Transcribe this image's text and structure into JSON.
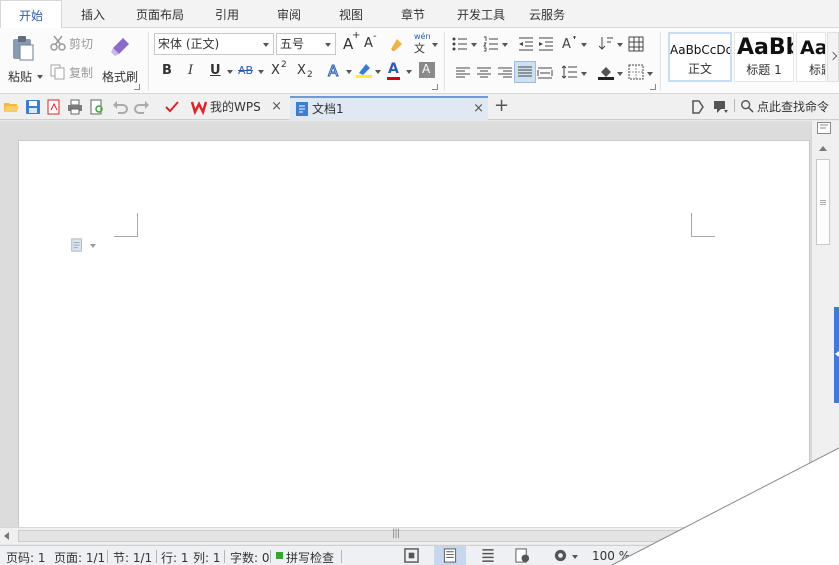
{
  "menu": {
    "tabs": [
      "开始",
      "插入",
      "页面布局",
      "引用",
      "审阅",
      "视图",
      "章节",
      "开发工具",
      "云服务"
    ],
    "active_index": 0
  },
  "clipboard": {
    "paste_label": "粘贴",
    "cut_label": "剪切",
    "copy_label": "复制",
    "format_painter_label": "格式刷"
  },
  "font": {
    "family_value": "宋体 (正文)",
    "size_value": "五号",
    "bold_glyph": "B",
    "italic_glyph": "I",
    "underline_glyph": "U",
    "strike_glyph": "AB",
    "superscript_glyph": "X",
    "sup_mark": "2",
    "subscript_glyph": "X",
    "sub_mark": "2",
    "grow_glyph": "A",
    "grow_mark": "+",
    "shrink_glyph": "A",
    "shrink_mark": "-",
    "phonetic_top": "wén",
    "phonetic_bottom": "文",
    "effect_glyph": "A",
    "color_glyph": "A",
    "shade_glyph": "A",
    "color_accent": "#d0021b"
  },
  "styles": [
    {
      "preview": "AaBbCcDd",
      "name": "正文"
    },
    {
      "preview": "AaBb",
      "name": "标题 1"
    },
    {
      "preview": "Aa",
      "name": "标题"
    }
  ],
  "quickbar": {
    "tabs": [
      {
        "label": "我的WPS",
        "icon": "wps-logo-icon"
      },
      {
        "label": "文档1",
        "icon": "document-icon"
      }
    ],
    "close_glyph": "×",
    "new_tab_glyph": "+",
    "search_label": "点此查找命令"
  },
  "scroll": {
    "hscroll_grip": "|||"
  },
  "status": {
    "page_no": "页码: 1",
    "pages": "页面: 1/1",
    "section": "节: 1/1",
    "line": "行: 1",
    "column": "列: 1",
    "word_count": "字数: 0",
    "spell_check": "拼写检查",
    "zoom": "100 %"
  },
  "colors": {
    "accent_blue": "#2a5db0",
    "wps_red": "#d9262c",
    "spell_green": "#3aa335"
  }
}
